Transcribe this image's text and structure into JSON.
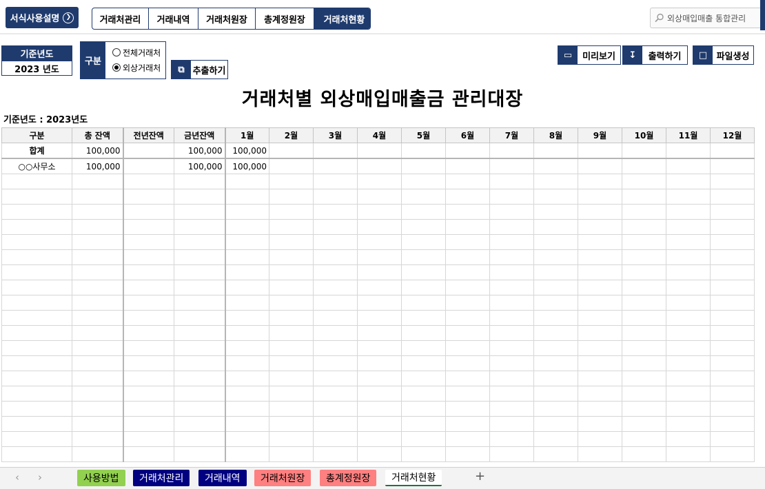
{
  "header": {
    "help_button": "서식사용설명",
    "tabs": [
      {
        "label": "거래처관리",
        "active": false
      },
      {
        "label": "거래내역",
        "active": false
      },
      {
        "label": "거래처원장",
        "active": false
      },
      {
        "label": "총계정원장",
        "active": false
      },
      {
        "label": "거래처현황",
        "active": true
      }
    ],
    "search_text": "외상매입매출 통합관리"
  },
  "controls": {
    "year_label": "기준년도",
    "year_value": "2023 년도",
    "gubun_label": "구분",
    "options": [
      {
        "label": "전체거래처",
        "selected": false
      },
      {
        "label": "외상거래처",
        "selected": true
      }
    ],
    "extract_button": "추출하기",
    "preview_button": "미리보기",
    "print_button": "출력하기",
    "file_button": "파일생성"
  },
  "report": {
    "title": "거래처별 외상매입매출금 관리대장",
    "basis": "기준년도 : 2023년도",
    "columns": [
      "구분",
      "총 잔액",
      "전년잔액",
      "금년잔액",
      "1월",
      "2월",
      "3월",
      "4월",
      "5월",
      "6월",
      "7월",
      "8월",
      "9월",
      "10월",
      "11월",
      "12월"
    ],
    "summary": [
      "합계",
      "100,000",
      "",
      "100,000",
      "100,000",
      "",
      "",
      "",
      "",
      "",
      "",
      "",
      "",
      "",
      "",
      ""
    ],
    "rows": [
      [
        "○○사무소",
        "100,000",
        "",
        "100,000",
        "100,000",
        "",
        "",
        "",
        "",
        "",
        "",
        "",
        "",
        "",
        "",
        ""
      ]
    ]
  },
  "sheet_tabs": [
    {
      "label": "사용방법",
      "bg": "#92d050",
      "fg": "#000000"
    },
    {
      "label": "거래처관리",
      "bg": "#000080",
      "fg": "#ffffff"
    },
    {
      "label": "거래내역",
      "bg": "#000080",
      "fg": "#ffffff"
    },
    {
      "label": "거래처원장",
      "bg": "#ff8080",
      "fg": "#000000"
    },
    {
      "label": "총계정원장",
      "bg": "#ff8080",
      "fg": "#000000"
    },
    {
      "label": "거래처현황",
      "bg": "#ffffff",
      "fg": "#000000"
    }
  ],
  "colors": {
    "brand": "#1f3b6e"
  }
}
